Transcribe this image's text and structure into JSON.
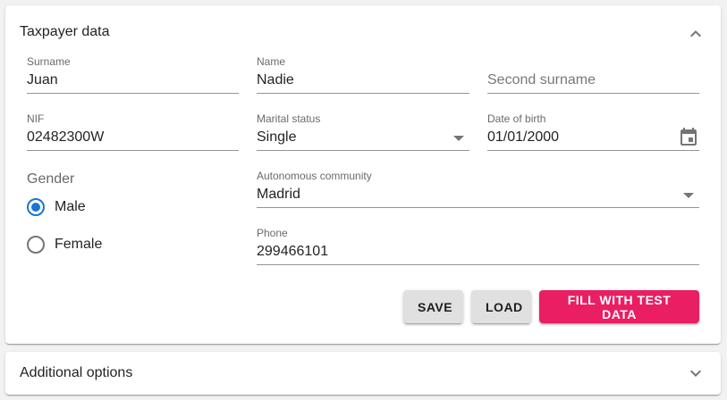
{
  "taxpayer_panel": {
    "title": "Taxpayer data",
    "expanded": true,
    "fields": {
      "surname": {
        "label": "Surname",
        "value": "Juan"
      },
      "name": {
        "label": "Name",
        "value": "Nadie"
      },
      "second_surname": {
        "placeholder": "Second surname",
        "value": ""
      },
      "nif": {
        "label": "NIF",
        "value": "02482300W"
      },
      "marital_status": {
        "label": "Marital status",
        "value": "Single"
      },
      "date_of_birth": {
        "label": "Date of birth",
        "value": "01/01/2000"
      },
      "autonomous_community": {
        "label": "Autonomous community",
        "value": "Madrid"
      },
      "phone": {
        "label": "Phone",
        "value": "299466101"
      }
    },
    "gender": {
      "title": "Gender",
      "options": [
        {
          "label": "Male",
          "selected": true
        },
        {
          "label": "Female",
          "selected": false
        }
      ]
    },
    "buttons": {
      "save": "SAVE",
      "load": "LOAD",
      "fill_test": "FILL WITH TEST DATA"
    }
  },
  "additional_panel": {
    "title": "Additional options",
    "expanded": false
  },
  "colors": {
    "primary": "#1976d2",
    "accent": "#e91e63",
    "button_default": "#e0e0e0"
  },
  "icons": {
    "expand_less": "chevron-up-icon",
    "expand_more": "chevron-down-icon",
    "calendar": "calendar-icon",
    "dropdown": "dropdown-arrow-icon"
  }
}
